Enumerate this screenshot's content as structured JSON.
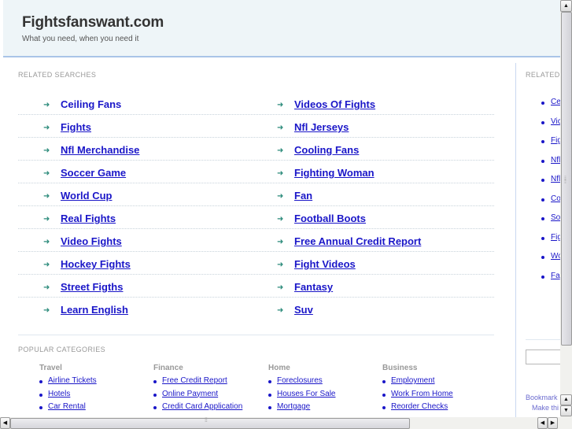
{
  "header": {
    "title": "Fightsfanswant.com",
    "tagline": "What you need, when you need it"
  },
  "related_searches": {
    "label": "RELATED SEARCHES",
    "rows": [
      [
        "Ceiling Fans",
        "Videos Of Fights"
      ],
      [
        "Fights",
        "Nfl Jerseys"
      ],
      [
        "Nfl Merchandise",
        "Cooling Fans"
      ],
      [
        "Soccer Game",
        "Fighting Woman"
      ],
      [
        "World Cup",
        "Fan"
      ],
      [
        "Real Fights",
        "Football Boots"
      ],
      [
        "Video Fights",
        "Free Annual Credit Report"
      ],
      [
        "Hockey Fights",
        "Fight Videos"
      ],
      [
        "Street Figths",
        "Fantasy"
      ],
      [
        "Learn English",
        "Suv"
      ]
    ],
    "arrow_icon": "➜"
  },
  "popular_categories": {
    "label": "POPULAR CATEGORIES",
    "columns": [
      {
        "title": "Travel",
        "items": [
          "Airline Tickets",
          "Hotels",
          "Car Rental"
        ]
      },
      {
        "title": "Finance",
        "items": [
          "Free Credit Report",
          "Online Payment",
          "Credit Card Application"
        ]
      },
      {
        "title": "Home",
        "items": [
          "Foreclosures",
          "Houses For Sale",
          "Mortgage"
        ]
      },
      {
        "title": "Business",
        "items": [
          "Employment",
          "Work From Home",
          "Reorder Checks"
        ]
      }
    ]
  },
  "sidebar": {
    "label": "RELATED",
    "items": [
      "Ce",
      "Vic",
      "Fig",
      "Nfl",
      "Nfl",
      "Co",
      "So",
      "Fig",
      "Wo",
      "Fa"
    ],
    "search_value": "",
    "bookmark": "Bookmark",
    "make": "Make thi"
  },
  "scrollbars": {
    "up": "▲",
    "down": "▼",
    "left": "◀",
    "right": "▶"
  },
  "colors": {
    "link": "#1a16c8",
    "header_bg": "#eef5f8",
    "header_border": "#a9c4e8",
    "arrow": "#2a8a7a"
  }
}
